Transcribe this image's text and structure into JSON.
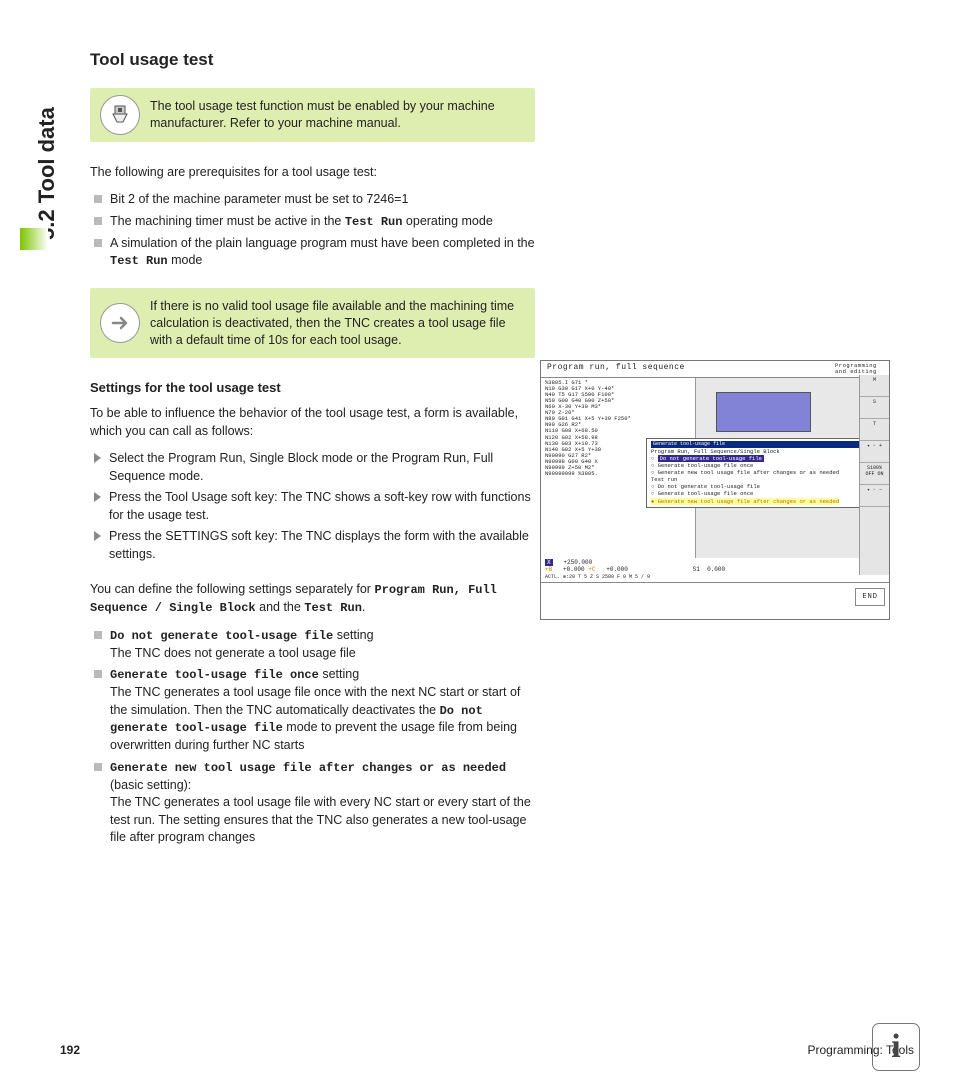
{
  "side_heading": "5.2 Tool data",
  "heading": "Tool usage test",
  "note1": "The tool usage test function must be enabled by your machine manufacturer. Refer to your machine manual.",
  "intro": "The following are prerequisites for a tool usage test:",
  "prereq": {
    "a": "Bit 2 of the machine parameter must be set to 7246=1",
    "b_pre": "The machining timer must be active in the ",
    "b_code": "Test Run",
    "b_post": " operating mode",
    "c_pre": "A simulation of the plain language program must have been completed in the ",
    "c_code": "Test Run",
    "c_post": " mode"
  },
  "note2": "If there is no valid tool usage file available and the machining time calculation is deactivated, then the TNC creates a tool usage file with a default time of 10s for each tool usage.",
  "sub1_title": "Settings for the tool usage test",
  "sub1_intro": "To be able to influence the behavior of the tool usage test, a form is available, which you can call as follows:",
  "steps": {
    "a": "Select the Program Run, Single Block mode or the Program Run, Full Sequence mode.",
    "b": "Press the Tool Usage soft key: The TNC shows a soft-key row with functions for the usage test.",
    "c": "Press the SETTINGS soft key: The TNC displays the form with the available settings."
  },
  "para2_pre": "You can define the following settings separately for ",
  "para2_code1": "Program Run, Full Sequence / Single Block",
  "para2_mid": " and the ",
  "para2_code2": "Test Run",
  "para2_post": ".",
  "opts": {
    "a_code": "Do not generate tool-usage file",
    "a_label": " setting",
    "a_body": "The TNC does not generate a tool usage file",
    "b_code": "Generate tool-usage file once",
    "b_label": " setting",
    "b_body_pre": "The TNC generates a tool usage file once with the next NC start or start of the simulation. Then the TNC automatically deactivates the ",
    "b_body_code": "Do not generate tool-usage file",
    "b_body_post": " mode to prevent the usage file from being overwritten during further NC starts",
    "c_code": "Generate new tool usage file after changes or as needed",
    "c_label": " (basic setting):",
    "c_body": "The TNC generates a tool usage file with every NC start or every start of the test run. The setting ensures that the TNC also generates a new tool-usage file after program changes"
  },
  "shot": {
    "title_left": "Program run, full sequence",
    "title_right": "Programming and editing",
    "code": "%3805.I G71 *\nN10 G30 G17 X+0 Y-40*\nN40 T5 G17 S500 F100*\nN50 G00 G40 G90 Z+50*\nN60 X-30 Y+30 M3*\nN70 Z-20*\nN80 G01 G41 X+5 Y+30 F250*\nN90 G26 R2*\nN110 G08 X+68.50\nN120 G02 X+58.98\nN130 G03 X+19.73\nN140 G02 X+5 Y+30\nN90090 G27 R2*\nN99998 G00 G40 X\nN99999 Z+50 M2*\nN99999999 %3805.",
    "dlg_title": "Generate tool-usage file",
    "dlg_group1": "Program Run, Full Sequence/Single Block",
    "dlg_o1": "Do not generate tool-usage file",
    "dlg_o2": "Generate tool-usage file once",
    "dlg_o3": "Generate new tool usage file after changes or as needed",
    "dlg_group2": "Test run",
    "dlg_o4": "Do not generate tool-usage file",
    "dlg_o5": "Generate tool-usage file once",
    "dlg_o6": "Generate new tool usage file after changes or as needed",
    "status_x": "X",
    "status_xv": "+250.000",
    "status_b": "+B",
    "status_bv": "+0.000",
    "status_c": "+C",
    "status_cv": "+0.000",
    "status_s": "S1",
    "status_sv": "0.000",
    "status_line3": "ACTL.      ⊕:20      T 5      Z S 2500   F 0      M 5 / 9",
    "side_m": "M",
    "side_s": "S",
    "side_t": "T",
    "side_100": "S100%",
    "side_off": "OFF",
    "side_on": "ON",
    "end": "END"
  },
  "footer": {
    "page": "192",
    "chapter": "Programming: Tools"
  },
  "info_glyph": "i"
}
